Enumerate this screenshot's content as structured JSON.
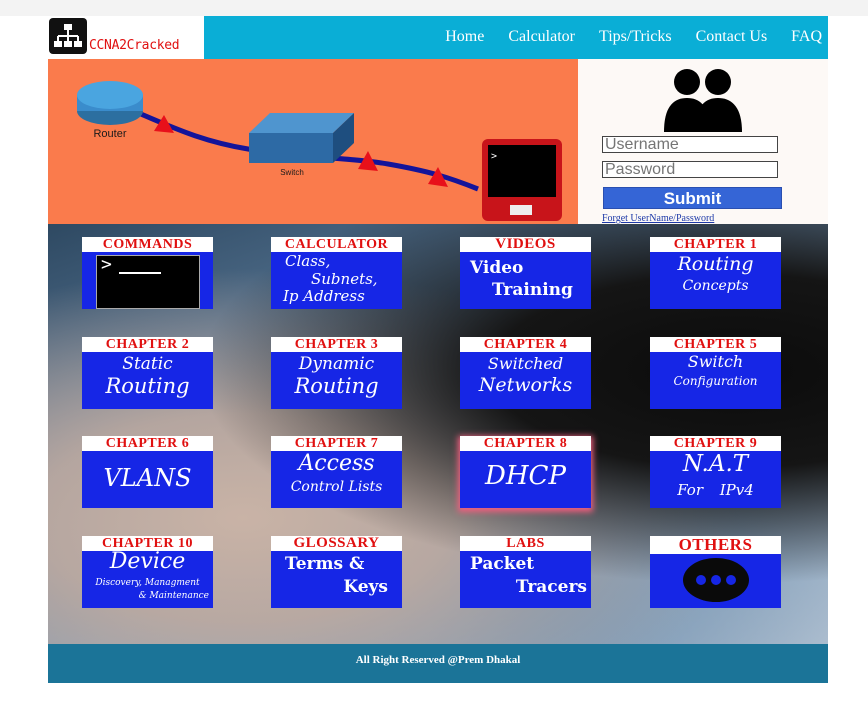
{
  "header": {
    "logo_text": "CCNA2Cracked",
    "nav": [
      "Home",
      "Calculator",
      "Tips/Tricks",
      "Contact Us",
      "FAQ"
    ]
  },
  "hero": {
    "router_label": "Router",
    "switch_label": "Switch"
  },
  "login": {
    "username_placeholder": "Username",
    "password_placeholder": "Password",
    "submit": "Submit",
    "forgot": "Forget UserName/Password"
  },
  "tiles": [
    {
      "head": "COMMANDS",
      "lines": []
    },
    {
      "head": "CALCULATOR",
      "lines": [
        "Class,",
        "Subnets,",
        "Ip Address"
      ]
    },
    {
      "head": "VIDEOS",
      "lines": [
        "Video",
        "Training"
      ]
    },
    {
      "head": "CHAPTER 1",
      "lines": [
        "Routing",
        "Concepts"
      ]
    },
    {
      "head": "CHAPTER 2",
      "lines": [
        "Static",
        "Routing"
      ]
    },
    {
      "head": "CHAPTER 3",
      "lines": [
        "Dynamic",
        "Routing"
      ]
    },
    {
      "head": "CHAPTER 4",
      "lines": [
        "Switched",
        "Networks"
      ]
    },
    {
      "head": "CHAPTER 5",
      "lines": [
        "Switch",
        "Configuration"
      ]
    },
    {
      "head": "CHAPTER 6",
      "lines": [
        "VLANS"
      ]
    },
    {
      "head": "CHAPTER 7",
      "lines": [
        "Access",
        "Control Lists"
      ]
    },
    {
      "head": "CHAPTER 8",
      "lines": [
        "DHCP"
      ]
    },
    {
      "head": "CHAPTER 9",
      "lines": [
        "N.A.T",
        "For IPv4"
      ]
    },
    {
      "head": "CHAPTER 10",
      "lines": [
        "Device",
        "Discovery, Managment",
        "& Maintenance"
      ]
    },
    {
      "head": "GLOSSARY",
      "lines": [
        "Terms &",
        "Keys"
      ]
    },
    {
      "head": "LABS",
      "lines": [
        "Packet",
        "Tracers"
      ]
    },
    {
      "head": "OTHERS",
      "lines": []
    }
  ],
  "footer": {
    "text": "All Right Reserved @Prem Dhakal"
  }
}
